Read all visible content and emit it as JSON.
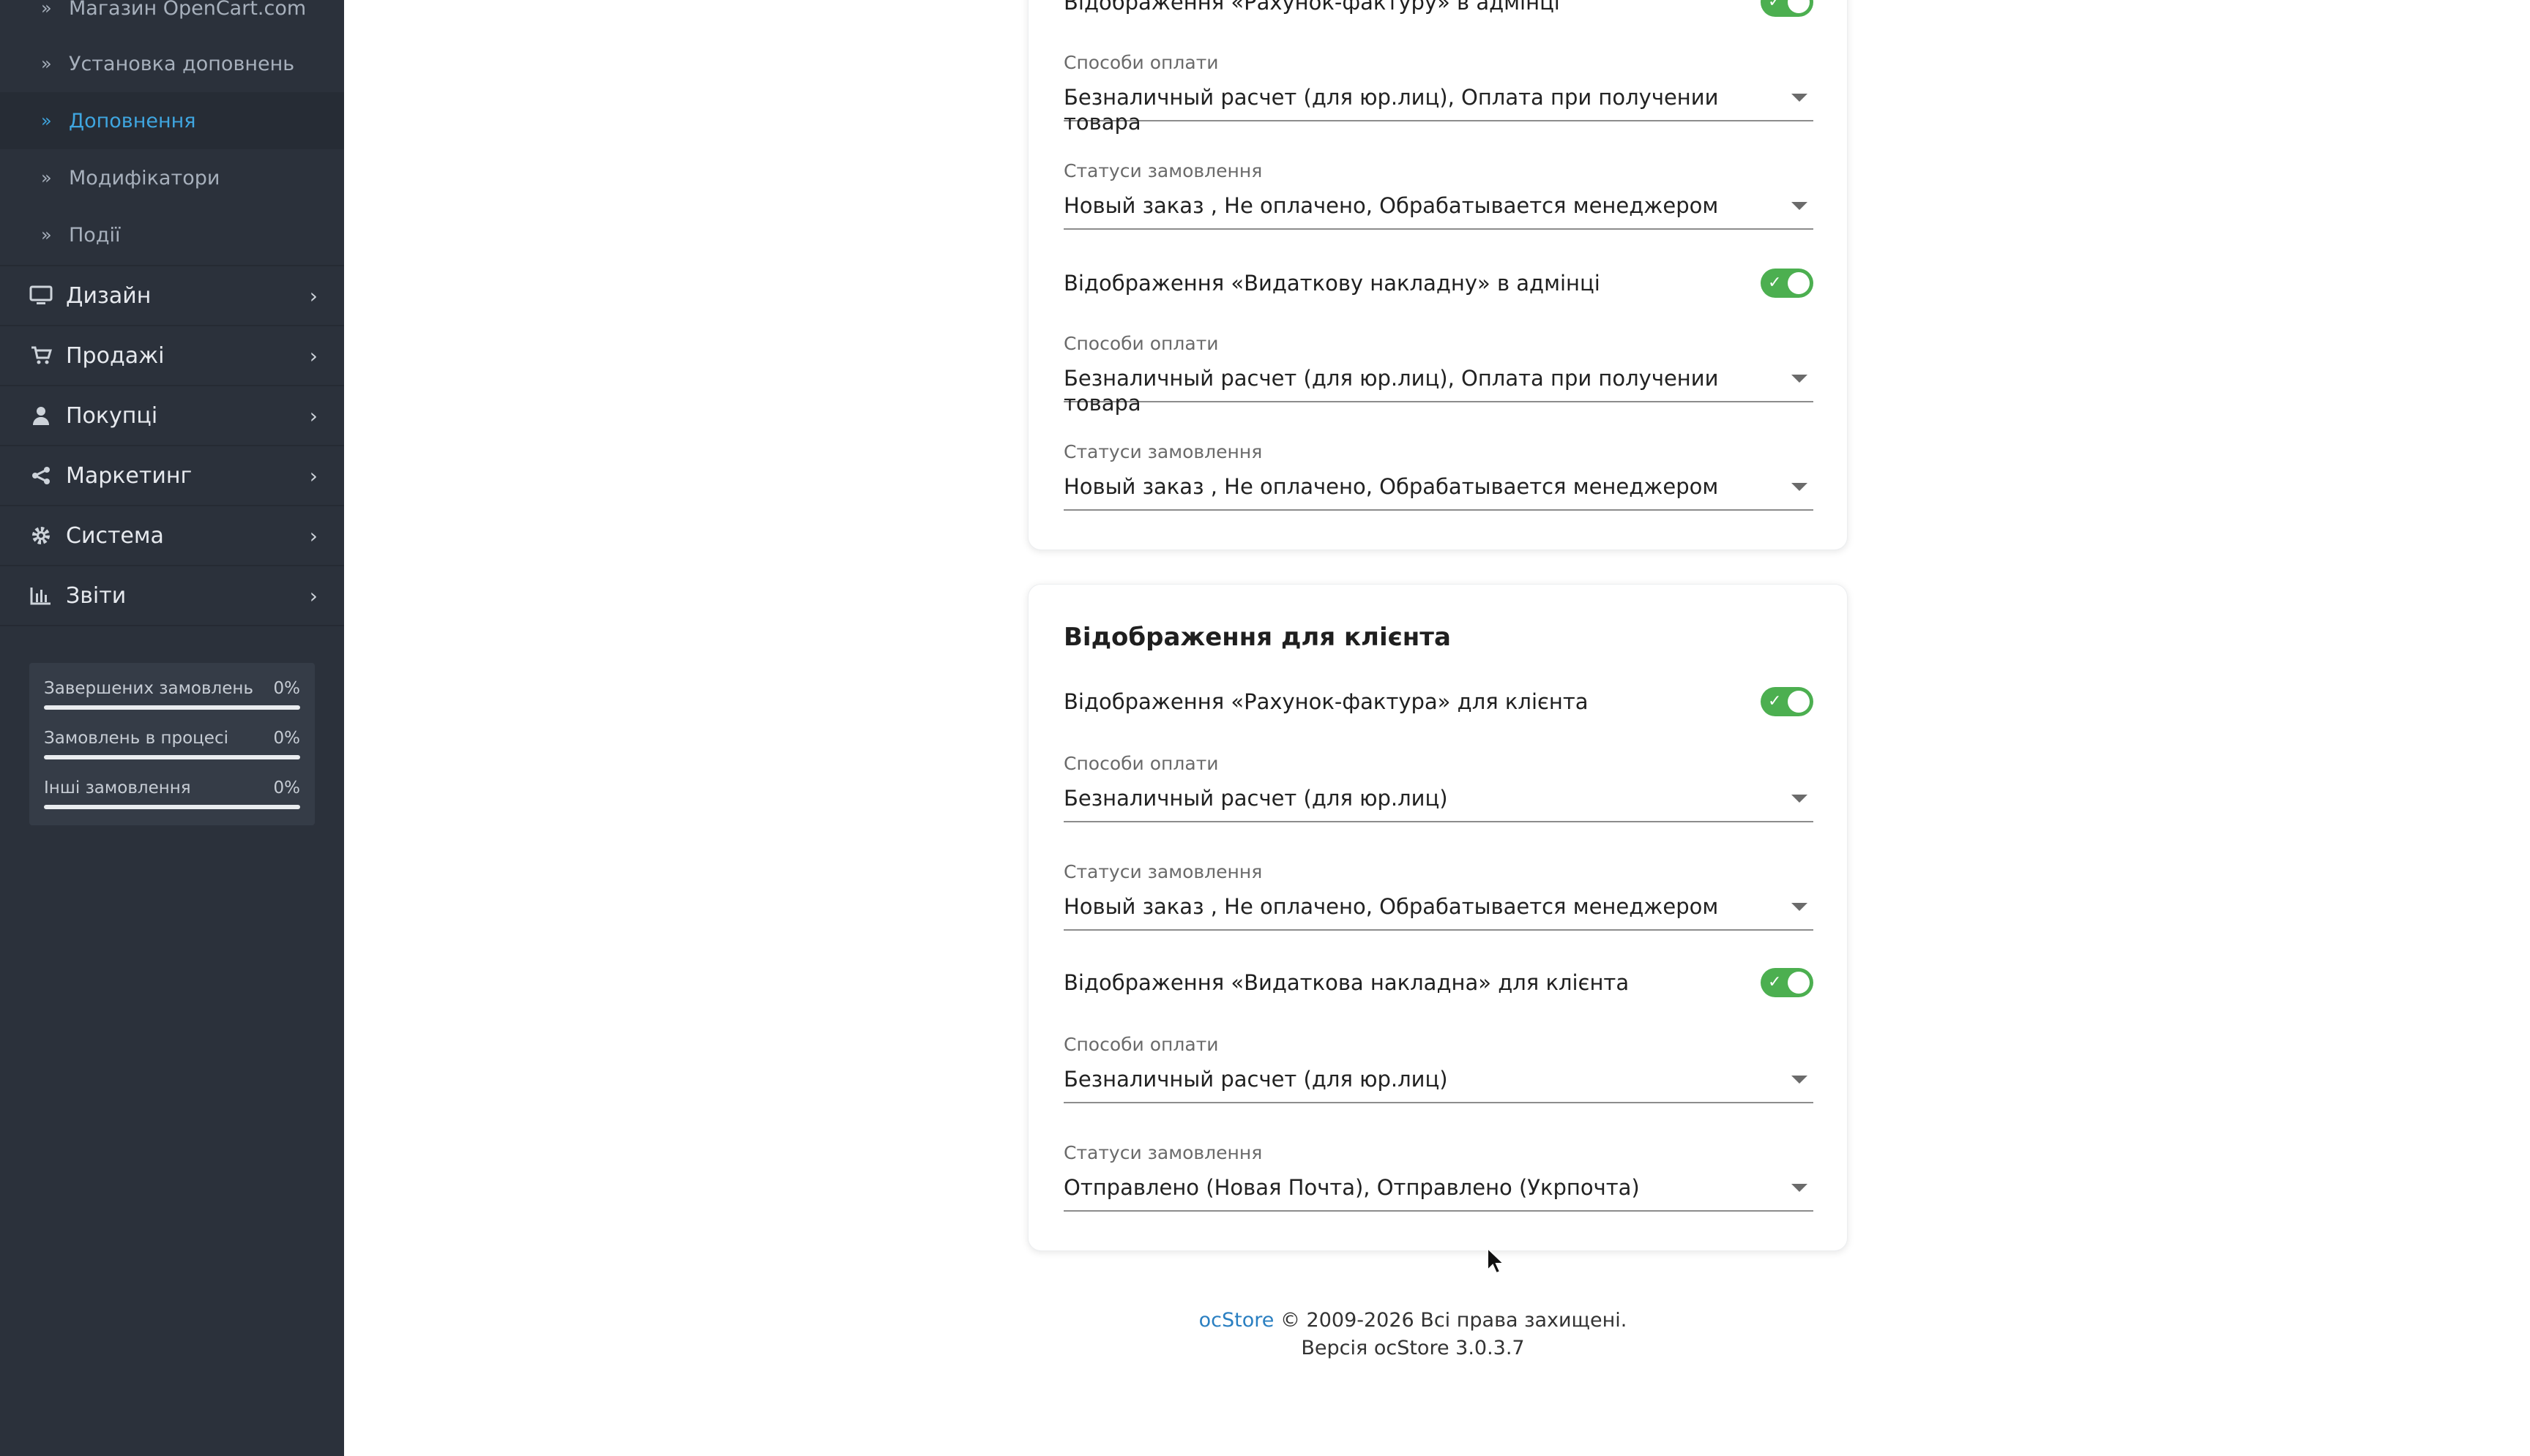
{
  "sidebar": {
    "sub_items": [
      {
        "label": "Магазин OpenCart.com"
      },
      {
        "label": "Установка доповнень"
      },
      {
        "label": "Доповнення"
      },
      {
        "label": "Модифікатори"
      },
      {
        "label": "Події"
      }
    ],
    "menu": [
      {
        "label": "Дизайн",
        "icon": "monitor-icon"
      },
      {
        "label": "Продажі",
        "icon": "cart-icon"
      },
      {
        "label": "Покупці",
        "icon": "user-icon"
      },
      {
        "label": "Маркетинг",
        "icon": "share-icon"
      },
      {
        "label": "Система",
        "icon": "gear-icon"
      },
      {
        "label": "Звіти",
        "icon": "bar-chart-icon"
      }
    ],
    "stats": [
      {
        "label": "Завершених замовлень",
        "value": "0%",
        "fill": 0
      },
      {
        "label": "Замовлень в процесі",
        "value": "0%",
        "fill": 0
      },
      {
        "label": "Інші замовлення",
        "value": "0%",
        "fill": 0
      }
    ]
  },
  "admin_card": {
    "toggle1_label": "Відображення «Рахунок-фактуру» в адмінці",
    "field1_label": "Способи оплати",
    "field1_value": "Безналичный расчет (для юр.лиц), Оплата при получении товара",
    "field2_label": "Статуси замовлення",
    "field2_value": "Новый заказ , Не оплачено, Обрабатывается менеджером",
    "toggle2_label": "Відображення «Видаткову накладну» в адмінці",
    "field3_label": "Способи оплати",
    "field3_value": "Безналичный расчет (для юр.лиц), Оплата при получении товара",
    "field4_label": "Статуси замовлення",
    "field4_value": "Новый заказ , Не оплачено, Обрабатывается менеджером"
  },
  "client_card": {
    "title": "Відображення для клієнта",
    "toggle1_label": "Відображення «Рахунок-фактура» для клієнта",
    "field1_label": "Способи оплати",
    "field1_value": "Безналичный расчет (для юр.лиц)",
    "field2_label": "Статуси замовлення",
    "field2_value": "Новый заказ , Не оплачено, Обрабатывается менеджером",
    "toggle2_label": "Відображення «Видаткова накладна» для клієнта",
    "field3_label": "Способи оплати",
    "field3_value": "Безналичный расчет (для юр.лиц)",
    "field4_label": "Статуси замовлення",
    "field4_value": "Отправлено (Новая Почта), Отправлено (Укрпочта)"
  },
  "footer": {
    "brand": "ocStore",
    "copyright": "© 2009-2026 Всі права захищені.",
    "version": "Версія ocStore 3.0.3.7"
  },
  "colors": {
    "sidebar_bg": "#2b313b",
    "accent": "#3fa6e0",
    "toggle_on": "#4caf50"
  }
}
